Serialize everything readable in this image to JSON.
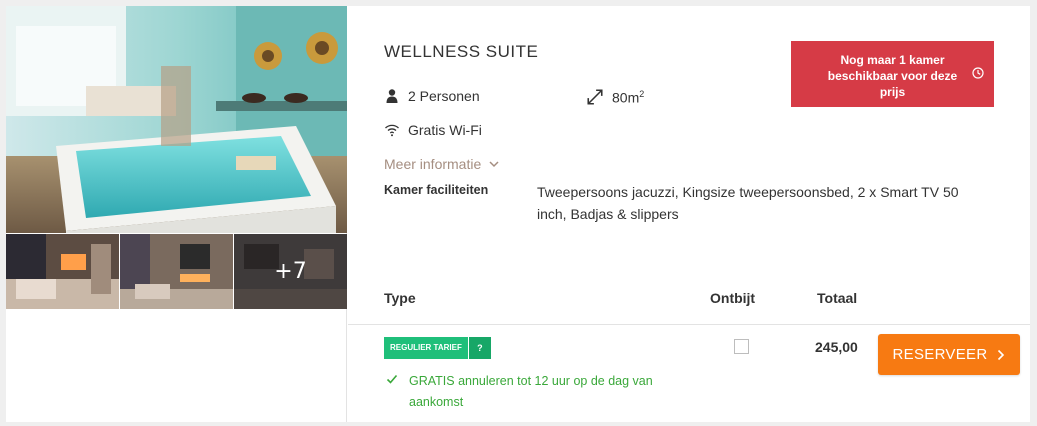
{
  "room": {
    "title": "WELLNESS SUITE",
    "persons": "2 Personen",
    "size": "80m",
    "size_sup": "2",
    "wifi": "Gratis Wi-Fi",
    "more_info": "Meer informatie",
    "facilities_label": "Kamer faciliteiten",
    "facilities_value": "Tweepersoons jacuzzi, Kingsize tweepersoonsbed, 2 x Smart TV 50 inch, Badjas & slippers"
  },
  "alert": {
    "text": "Nog maar 1 kamer beschikbaar voor deze prijs",
    "icon": "clock-icon",
    "color": "#d63b46"
  },
  "gallery": {
    "more_count": "+7"
  },
  "table": {
    "headers": {
      "type": "Type",
      "ontbijt": "Ontbijt",
      "totaal": "Totaal"
    },
    "rows": [
      {
        "rate_label": "REGULIER TARIEF",
        "help": "?",
        "cancel": "GRATIS annuleren tot 12 uur op de dag van aankomst",
        "breakfast_checked": false,
        "total": "245,00",
        "button": "RESERVEER"
      }
    ]
  },
  "colors": {
    "accent_orange": "#f77a12",
    "badge_green": "#1fbf7a",
    "cancel_green": "#3aa83a",
    "link_brown": "#a58e81"
  }
}
